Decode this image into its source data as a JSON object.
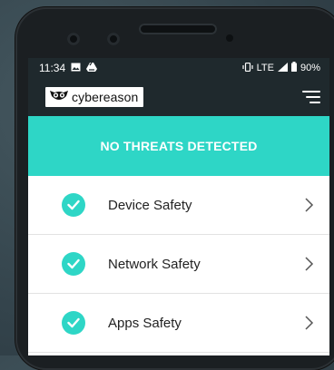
{
  "status_bar": {
    "time": "11:34",
    "network": "LTE",
    "battery": "90%"
  },
  "app": {
    "brand_name": "cybereason"
  },
  "banner": {
    "text": "NO THREATS DETECTED"
  },
  "items": [
    {
      "label": "Device Safety"
    },
    {
      "label": "Network Safety"
    },
    {
      "label": "Apps Safety"
    }
  ],
  "colors": {
    "accent": "#2ed6c6",
    "appbar": "#1f292d"
  },
  "icons": [
    "image-icon",
    "drive-icon",
    "vibrate-icon",
    "signal-icon",
    "battery-icon",
    "owl-logo-icon",
    "hamburger-menu-icon",
    "check-circle-icon",
    "chevron-right-icon"
  ]
}
